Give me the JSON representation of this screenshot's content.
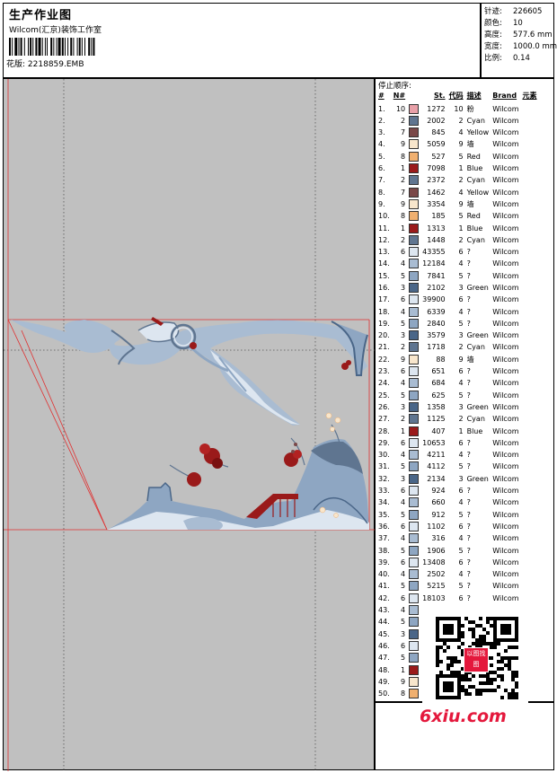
{
  "header": {
    "title": "生产作业图",
    "company": "Wilcom(汇京)装饰工作室",
    "design_file_label": "花版:",
    "design_file": "2218859.EMB"
  },
  "meta": [
    {
      "label": "针迹:",
      "value": "226605"
    },
    {
      "label": "颜色:",
      "value": "10"
    },
    {
      "label": "高度:",
      "value": "577.6 mm"
    },
    {
      "label": "宽度:",
      "value": "1000.0 mm"
    },
    {
      "label": "比例:",
      "value": "0.14"
    }
  ],
  "stop_sequence_title": "停止顺序:",
  "columns": [
    "#",
    "N#",
    "St.",
    "代码",
    "描述",
    "Brand",
    "元素"
  ],
  "rows": [
    {
      "idx": "1.",
      "n": "10",
      "st": "1272",
      "code": "10",
      "desc": "粉",
      "brand": "Wilcom",
      "color": "#e8a0a8"
    },
    {
      "idx": "2.",
      "n": "2",
      "st": "2002",
      "code": "2",
      "desc": "Cyan",
      "brand": "Wilcom",
      "color": "#5f7590"
    },
    {
      "idx": "3.",
      "n": "7",
      "st": "845",
      "code": "4",
      "desc": "Yellow",
      "brand": "Wilcom",
      "color": "#7a4848"
    },
    {
      "idx": "4.",
      "n": "9",
      "st": "5059",
      "code": "9",
      "desc": "墙",
      "brand": "Wilcom",
      "color": "#f8e6cc"
    },
    {
      "idx": "5.",
      "n": "8",
      "st": "527",
      "code": "5",
      "desc": "Red",
      "brand": "Wilcom",
      "color": "#f0b070"
    },
    {
      "idx": "6.",
      "n": "1",
      "st": "7098",
      "code": "1",
      "desc": "Blue",
      "brand": "Wilcom",
      "color": "#9a1a1a"
    },
    {
      "idx": "7.",
      "n": "2",
      "st": "2372",
      "code": "2",
      "desc": "Cyan",
      "brand": "Wilcom",
      "color": "#5f7590"
    },
    {
      "idx": "8.",
      "n": "7",
      "st": "1462",
      "code": "4",
      "desc": "Yellow",
      "brand": "Wilcom",
      "color": "#7a4848"
    },
    {
      "idx": "9.",
      "n": "9",
      "st": "3354",
      "code": "9",
      "desc": "墙",
      "brand": "Wilcom",
      "color": "#f8e6cc"
    },
    {
      "idx": "10.",
      "n": "8",
      "st": "185",
      "code": "5",
      "desc": "Red",
      "brand": "Wilcom",
      "color": "#f0b070"
    },
    {
      "idx": "11.",
      "n": "1",
      "st": "1313",
      "code": "1",
      "desc": "Blue",
      "brand": "Wilcom",
      "color": "#9a1a1a"
    },
    {
      "idx": "12.",
      "n": "2",
      "st": "1448",
      "code": "2",
      "desc": "Cyan",
      "brand": "Wilcom",
      "color": "#5f7590"
    },
    {
      "idx": "13.",
      "n": "6",
      "st": "43355",
      "code": "6",
      "desc": "?",
      "brand": "Wilcom",
      "color": "#dde6f0"
    },
    {
      "idx": "14.",
      "n": "4",
      "st": "12184",
      "code": "4",
      "desc": "?",
      "brand": "Wilcom",
      "color": "#a9bcd2"
    },
    {
      "idx": "15.",
      "n": "5",
      "st": "7841",
      "code": "5",
      "desc": "?",
      "brand": "Wilcom",
      "color": "#8ea6c2"
    },
    {
      "idx": "16.",
      "n": "3",
      "st": "2102",
      "code": "3",
      "desc": "Green",
      "brand": "Wilcom",
      "color": "#4a6688"
    },
    {
      "idx": "17.",
      "n": "6",
      "st": "39900",
      "code": "6",
      "desc": "?",
      "brand": "Wilcom",
      "color": "#dde6f0"
    },
    {
      "idx": "18.",
      "n": "4",
      "st": "6339",
      "code": "4",
      "desc": "?",
      "brand": "Wilcom",
      "color": "#a9bcd2"
    },
    {
      "idx": "19.",
      "n": "5",
      "st": "2840",
      "code": "5",
      "desc": "?",
      "brand": "Wilcom",
      "color": "#8ea6c2"
    },
    {
      "idx": "20.",
      "n": "3",
      "st": "3579",
      "code": "3",
      "desc": "Green",
      "brand": "Wilcom",
      "color": "#4a6688"
    },
    {
      "idx": "21.",
      "n": "2",
      "st": "1718",
      "code": "2",
      "desc": "Cyan",
      "brand": "Wilcom",
      "color": "#5f7590"
    },
    {
      "idx": "22.",
      "n": "9",
      "st": "88",
      "code": "9",
      "desc": "墙",
      "brand": "Wilcom",
      "color": "#f8e6cc"
    },
    {
      "idx": "23.",
      "n": "6",
      "st": "651",
      "code": "6",
      "desc": "?",
      "brand": "Wilcom",
      "color": "#dde6f0"
    },
    {
      "idx": "24.",
      "n": "4",
      "st": "684",
      "code": "4",
      "desc": "?",
      "brand": "Wilcom",
      "color": "#a9bcd2"
    },
    {
      "idx": "25.",
      "n": "5",
      "st": "625",
      "code": "5",
      "desc": "?",
      "brand": "Wilcom",
      "color": "#8ea6c2"
    },
    {
      "idx": "26.",
      "n": "3",
      "st": "1358",
      "code": "3",
      "desc": "Green",
      "brand": "Wilcom",
      "color": "#4a6688"
    },
    {
      "idx": "27.",
      "n": "2",
      "st": "1125",
      "code": "2",
      "desc": "Cyan",
      "brand": "Wilcom",
      "color": "#5f7590"
    },
    {
      "idx": "28.",
      "n": "1",
      "st": "407",
      "code": "1",
      "desc": "Blue",
      "brand": "Wilcom",
      "color": "#9a1a1a"
    },
    {
      "idx": "29.",
      "n": "6",
      "st": "10653",
      "code": "6",
      "desc": "?",
      "brand": "Wilcom",
      "color": "#dde6f0"
    },
    {
      "idx": "30.",
      "n": "4",
      "st": "4211",
      "code": "4",
      "desc": "?",
      "brand": "Wilcom",
      "color": "#a9bcd2"
    },
    {
      "idx": "31.",
      "n": "5",
      "st": "4112",
      "code": "5",
      "desc": "?",
      "brand": "Wilcom",
      "color": "#8ea6c2"
    },
    {
      "idx": "32.",
      "n": "3",
      "st": "2134",
      "code": "3",
      "desc": "Green",
      "brand": "Wilcom",
      "color": "#4a6688"
    },
    {
      "idx": "33.",
      "n": "6",
      "st": "924",
      "code": "6",
      "desc": "?",
      "brand": "Wilcom",
      "color": "#dde6f0"
    },
    {
      "idx": "34.",
      "n": "4",
      "st": "660",
      "code": "4",
      "desc": "?",
      "brand": "Wilcom",
      "color": "#a9bcd2"
    },
    {
      "idx": "35.",
      "n": "5",
      "st": "912",
      "code": "5",
      "desc": "?",
      "brand": "Wilcom",
      "color": "#8ea6c2"
    },
    {
      "idx": "36.",
      "n": "6",
      "st": "1102",
      "code": "6",
      "desc": "?",
      "brand": "Wilcom",
      "color": "#dde6f0"
    },
    {
      "idx": "37.",
      "n": "4",
      "st": "316",
      "code": "4",
      "desc": "?",
      "brand": "Wilcom",
      "color": "#a9bcd2"
    },
    {
      "idx": "38.",
      "n": "5",
      "st": "1906",
      "code": "5",
      "desc": "?",
      "brand": "Wilcom",
      "color": "#8ea6c2"
    },
    {
      "idx": "39.",
      "n": "6",
      "st": "13408",
      "code": "6",
      "desc": "?",
      "brand": "Wilcom",
      "color": "#dde6f0"
    },
    {
      "idx": "40.",
      "n": "4",
      "st": "2502",
      "code": "4",
      "desc": "?",
      "brand": "Wilcom",
      "color": "#a9bcd2"
    },
    {
      "idx": "41.",
      "n": "5",
      "st": "5215",
      "code": "5",
      "desc": "?",
      "brand": "Wilcom",
      "color": "#8ea6c2"
    },
    {
      "idx": "42.",
      "n": "6",
      "st": "18103",
      "code": "6",
      "desc": "?",
      "brand": "Wilcom",
      "color": "#dde6f0"
    },
    {
      "idx": "43.",
      "n": "4",
      "st": "",
      "code": "",
      "desc": "",
      "brand": "",
      "color": "#a9bcd2"
    },
    {
      "idx": "44.",
      "n": "5",
      "st": "",
      "code": "",
      "desc": "",
      "brand": "",
      "color": "#8ea6c2"
    },
    {
      "idx": "45.",
      "n": "3",
      "st": "",
      "code": "",
      "desc": "",
      "brand": "",
      "color": "#4a6688"
    },
    {
      "idx": "46.",
      "n": "6",
      "st": "",
      "code": "",
      "desc": "",
      "brand": "",
      "color": "#dde6f0"
    },
    {
      "idx": "47.",
      "n": "5",
      "st": "",
      "code": "",
      "desc": "",
      "brand": "",
      "color": "#8ea6c2"
    },
    {
      "idx": "48.",
      "n": "1",
      "st": "",
      "code": "",
      "desc": "",
      "brand": "",
      "color": "#9a1a1a"
    },
    {
      "idx": "49.",
      "n": "9",
      "st": "",
      "code": "",
      "desc": "",
      "brand": "",
      "color": "#f8e6cc"
    },
    {
      "idx": "50.",
      "n": "8",
      "st": "",
      "code": "",
      "desc": "",
      "brand": "",
      "color": "#f0b070"
    }
  ],
  "qr_text": "以图找图",
  "watermark": "6xiu.com"
}
